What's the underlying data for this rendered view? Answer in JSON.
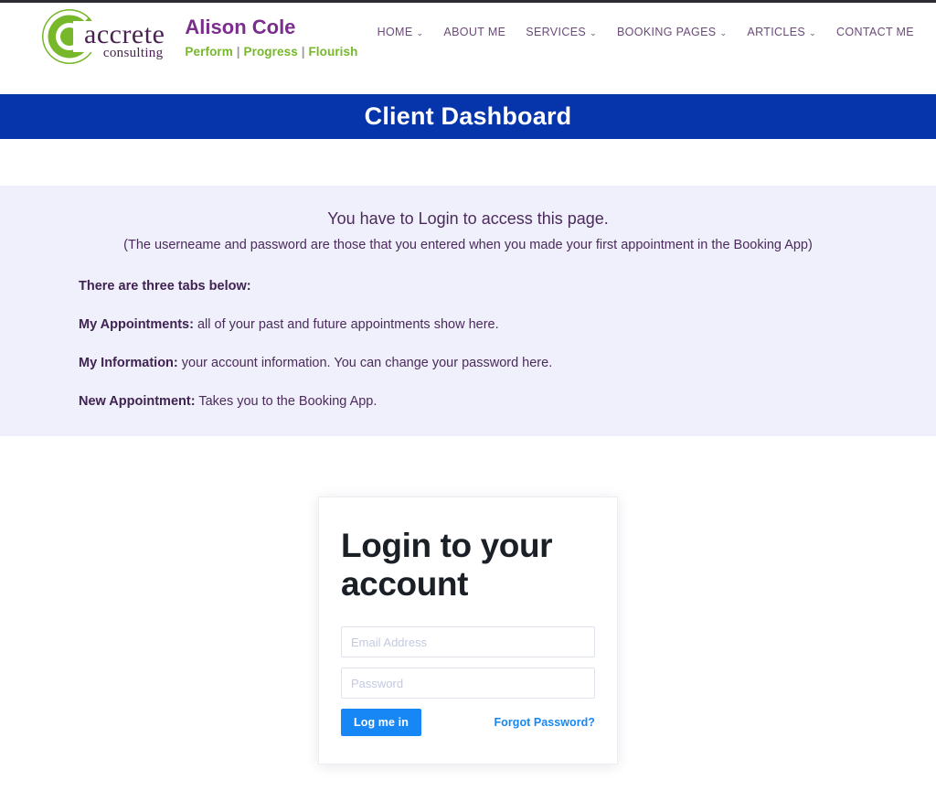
{
  "brand": {
    "logo_accrete": "accrete",
    "logo_tm": "™",
    "logo_consulting": "consulting",
    "name": "Alison Cole",
    "tagline_1": "Perform",
    "tagline_sep": "|",
    "tagline_2": "Progress",
    "tagline_3": "Flourish",
    "logo_green": "#76b82a",
    "logo_purple": "#4a2352",
    "name_purple": "#7b2d8e"
  },
  "nav": {
    "items": [
      {
        "label": "HOME",
        "has_chevron": true
      },
      {
        "label": "ABOUT ME",
        "has_chevron": false
      },
      {
        "label": "SERVICES",
        "has_chevron": true
      },
      {
        "label": "BOOKING PAGES",
        "has_chevron": true
      },
      {
        "label": "ARTICLES",
        "has_chevron": true
      },
      {
        "label": "CONTACT ME",
        "has_chevron": false
      }
    ],
    "chevron_glyph": "⌄"
  },
  "banner": {
    "title": "Client Dashboard",
    "background": "#0635ab",
    "text_color": "#ffffff"
  },
  "notice": {
    "background": "#f0effc",
    "line_1": "You have to Login to access this page.",
    "line_2": "(The userneame and password are those that you entered when you made your first appointment in the Booking App)",
    "tabs_heading": "There are three tabs below:",
    "tabs": [
      {
        "label": "My Appointments:",
        "description": " all of your past and future appointments show here."
      },
      {
        "label": "My Information:",
        "description": " your account information. You can change your password here."
      },
      {
        "label": "New Appointment:",
        "description": " Takes you to the Booking App."
      }
    ]
  },
  "login": {
    "title": "Login to your account",
    "email_placeholder": "Email Address",
    "email_value": "",
    "password_placeholder": "Password",
    "password_value": "",
    "submit_label": "Log me in",
    "forgot_label": "Forgot Password?",
    "accent_color": "#1787f5"
  }
}
